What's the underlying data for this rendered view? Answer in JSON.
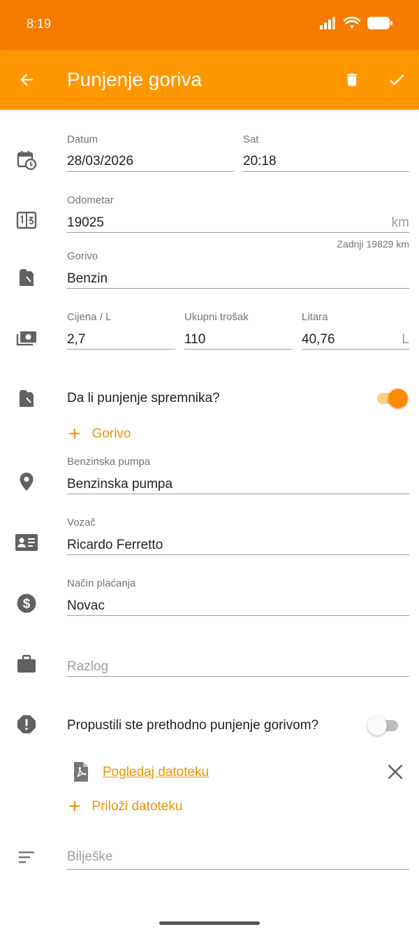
{
  "status_bar": {
    "time": "8:19"
  },
  "app_bar": {
    "title": "Punjenje goriva"
  },
  "colors": {
    "status_bar": "#f57c00",
    "app_bar": "#ff9800",
    "accent": "#ef9400"
  },
  "fields": {
    "datum": {
      "label": "Datum",
      "value": "28/03/2026"
    },
    "sat": {
      "label": "Sat",
      "value": "20:18"
    },
    "odometar": {
      "label": "Odometar",
      "value": "19025",
      "unit": "km",
      "helper": "Zadnji 19829 km"
    },
    "gorivo": {
      "label": "Gorivo",
      "value": "Benzin"
    },
    "cijena": {
      "label": "Cijena / L",
      "value": "2,7"
    },
    "ukupni_trosak": {
      "label": "Ukupni trošak",
      "value": "110"
    },
    "litara": {
      "label": "Litara",
      "value": "40,76",
      "unit": "L"
    },
    "benzinska_pumpa": {
      "label": "Benzinska pumpa",
      "value": "Benzinska pumpa"
    },
    "vozac": {
      "label": "Vozač",
      "value": "Ricardo Ferretto"
    },
    "nacin_placanja": {
      "label": "Način plaćanja",
      "value": "Novac"
    },
    "razlog": {
      "placeholder": "Razlog"
    },
    "biljeske": {
      "placeholder": "Bilješke"
    }
  },
  "toggles": {
    "full_tank": {
      "label": "Da li punjenje spremnika?",
      "on": true
    },
    "missed_fillup": {
      "label": "Propustili ste prethodno punjenje gorivom?",
      "on": false
    }
  },
  "buttons": {
    "add_fuel": "Gorivo",
    "view_file": "Pogledaj datoteku",
    "attach_file": "Priloži datoteku"
  },
  "icons": {
    "back": "arrow-left-icon",
    "delete": "trash-icon",
    "save": "check-icon",
    "date": "calendar-clock-icon",
    "odometer": "odometer-icon",
    "fuel": "fuel-can-icon",
    "money": "cash-icon",
    "location": "map-pin-icon",
    "driver": "id-card-icon",
    "payment": "dollar-circle-icon",
    "reason": "briefcase-icon",
    "warning": "alert-octagon-icon",
    "file": "pdf-file-icon",
    "close": "close-icon",
    "notes": "notes-lines-icon"
  }
}
